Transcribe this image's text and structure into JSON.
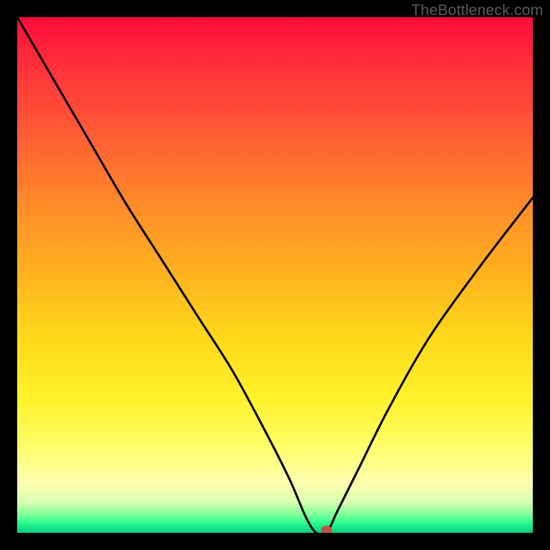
{
  "watermark": "TheBottleneck.com",
  "chart_data": {
    "type": "line",
    "title": "",
    "xlabel": "",
    "ylabel": "",
    "xlim": [
      0,
      100
    ],
    "ylim": [
      0,
      100
    ],
    "series": [
      {
        "name": "bottleneck-curve",
        "x": [
          0,
          7,
          14,
          21,
          28,
          35,
          42,
          49,
          53,
          56,
          58,
          60,
          62,
          66,
          72,
          80,
          90,
          100
        ],
        "values": [
          100,
          88,
          76,
          64,
          53,
          42,
          31,
          18,
          10,
          3,
          0,
          0,
          4,
          12,
          24,
          38,
          52,
          65
        ]
      }
    ],
    "annotations": [
      {
        "name": "marker-dot",
        "x": 60,
        "y": 0,
        "color": "#c1534a"
      }
    ],
    "background_gradient": {
      "top": "#ff1238",
      "mid": "#ffd81a",
      "bottom": "#13e387"
    },
    "grid": false,
    "legend": false
  }
}
